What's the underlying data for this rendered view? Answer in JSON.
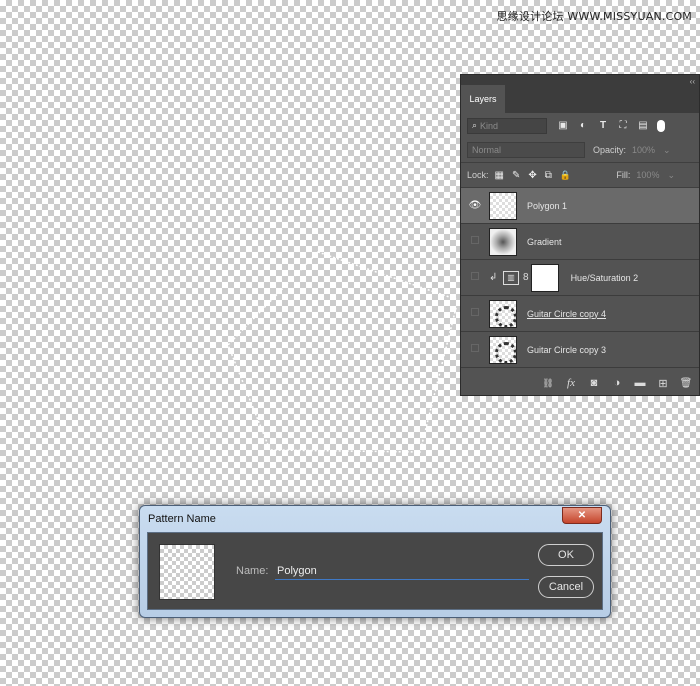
{
  "watermark": "思缘设计论坛 WWW.MISSYUAN.COM",
  "layers_panel": {
    "tab_label": "Layers",
    "collapse_glyph": "‹‹",
    "filter": {
      "kind_label": "Kind",
      "search_glyph": "⌕"
    },
    "filter_icons": [
      {
        "name": "pixel-filter-icon",
        "glyph": "▣"
      },
      {
        "name": "adjustment-filter-icon",
        "glyph": "◐"
      },
      {
        "name": "type-filter-icon",
        "glyph": "T"
      },
      {
        "name": "shape-filter-icon",
        "glyph": "⛶"
      },
      {
        "name": "smart-object-filter-icon",
        "glyph": "▤"
      }
    ],
    "blend_mode": "Normal",
    "opacity_label": "Opacity:",
    "opacity_value": "100%",
    "lock_label": "Lock:",
    "lock_icons": [
      {
        "name": "lock-transparent-icon",
        "glyph": "▦"
      },
      {
        "name": "lock-pixels-icon",
        "glyph": "✎"
      },
      {
        "name": "lock-position-icon",
        "glyph": "✥"
      },
      {
        "name": "lock-artboard-icon",
        "glyph": "⧉"
      },
      {
        "name": "lock-all-icon",
        "glyph": "🔒"
      }
    ],
    "fill_label": "Fill:",
    "fill_value": "100%",
    "dropdown_glyph": "⌄",
    "eye_glyph": "👁",
    "clip_glyph": "↲",
    "link_glyph": "8",
    "adj_glyph": "▥",
    "layers": [
      {
        "name": "Polygon 1",
        "visible": true,
        "selected": true
      },
      {
        "name": "Gradient",
        "visible": false
      },
      {
        "name": "Hue/Saturation 2",
        "visible": false
      },
      {
        "name": "Guitar Circle copy 4",
        "visible": false
      },
      {
        "name": "Guitar Circle copy 3",
        "visible": false
      }
    ],
    "footer_icons": [
      {
        "name": "link-layers-icon",
        "glyph": "⛓"
      },
      {
        "name": "fx-icon",
        "glyph": "fx"
      },
      {
        "name": "add-mask-icon",
        "glyph": "◙"
      },
      {
        "name": "new-adjustment-icon",
        "glyph": "◑"
      },
      {
        "name": "new-group-icon",
        "glyph": "▬"
      },
      {
        "name": "new-layer-icon",
        "glyph": "⊞"
      },
      {
        "name": "delete-layer-icon",
        "glyph": "🗑"
      }
    ]
  },
  "dialog": {
    "title": "Pattern Name",
    "close_glyph": "✕",
    "name_label": "Name:",
    "name_value": "Polygon",
    "ok_label": "OK",
    "cancel_label": "Cancel"
  }
}
